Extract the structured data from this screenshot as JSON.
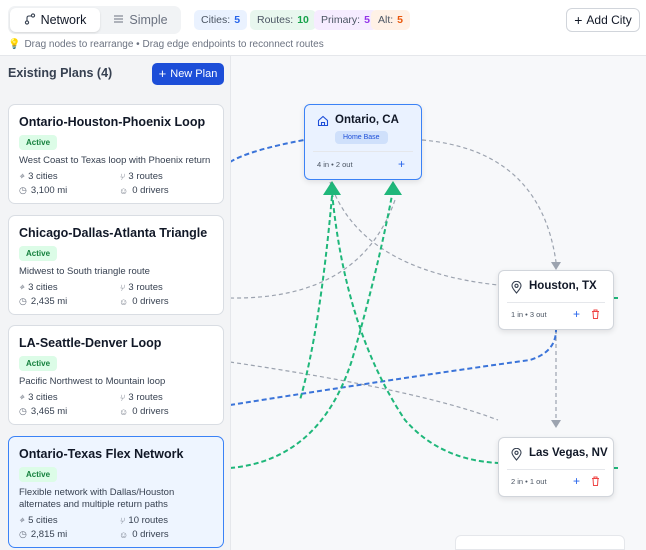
{
  "toolbar": {
    "network_label": "Network",
    "simple_label": "Simple",
    "cities_label": "Cities:",
    "cities_count": "5",
    "routes_label": "Routes:",
    "routes_count": "10",
    "primary_label": "Primary:",
    "primary_count": "5",
    "alt_label": "Alt:",
    "alt_count": "5",
    "add_city_label": "Add City"
  },
  "hint": "Drag nodes to rearrange • Drag edge endpoints to reconnect routes",
  "sidebar": {
    "title": "Existing Plans (4)",
    "new_plan_label": "New Plan",
    "plans": [
      {
        "title": "Ontario-Houston-Phoenix Loop",
        "status": "Active",
        "description": "West Coast to Texas loop with Phoenix return",
        "cities": "3 cities",
        "routes": "3 routes",
        "distance": "3,100 mi",
        "drivers": "0 drivers"
      },
      {
        "title": "Chicago-Dallas-Atlanta Triangle",
        "status": "Active",
        "description": "Midwest to South triangle route",
        "cities": "3 cities",
        "routes": "3 routes",
        "distance": "2,435 mi",
        "drivers": "0 drivers"
      },
      {
        "title": "LA-Seattle-Denver Loop",
        "status": "Active",
        "description": "Pacific Northwest to Mountain loop",
        "cities": "3 cities",
        "routes": "3 routes",
        "distance": "3,465 mi",
        "drivers": "0 drivers"
      },
      {
        "title": "Ontario-Texas Flex Network",
        "status": "Active",
        "description": "Flexible network with Dallas/Houston alternates and multiple return paths",
        "cities": "5 cities",
        "routes": "10 routes",
        "distance": "2,815 mi",
        "drivers": "0 drivers"
      }
    ]
  },
  "nodes": {
    "ontario": {
      "name": "Ontario, CA",
      "badge": "Home Base",
      "io": "4 in • 2 out"
    },
    "houston": {
      "name": "Houston, TX",
      "io": "1 in • 3 out"
    },
    "lasvegas": {
      "name": "Las Vegas, NV",
      "io": "2 in • 1 out"
    }
  },
  "colors": {
    "primary_route": "#1fb77a",
    "alt_route": "#3b74d9",
    "neutral_route": "#9ca3af",
    "accent": "#1d4ed8"
  },
  "icons": {
    "network": "route-icon",
    "simple": "list-icon",
    "add_city": "plus-icon",
    "hint": "lightbulb-icon",
    "home": "home-icon",
    "city": "map-pin-icon",
    "add_route": "plus-icon",
    "delete": "trash-icon"
  }
}
